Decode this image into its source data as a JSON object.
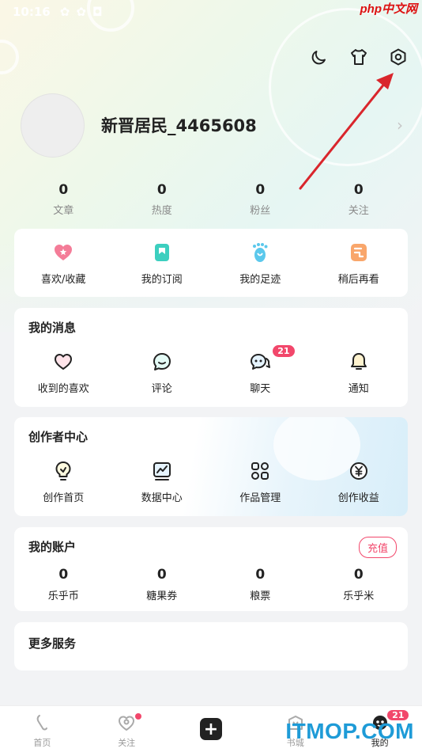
{
  "status_bar": {
    "time": "10:16"
  },
  "watermark_top": "php中文网",
  "watermark_bottom": "ITMOP.COM",
  "top_icons": [
    "moon-icon",
    "shirt-icon",
    "settings-icon"
  ],
  "profile": {
    "username": "新晋居民_4465608"
  },
  "stats": [
    {
      "value": "0",
      "label": "文章"
    },
    {
      "value": "0",
      "label": "热度"
    },
    {
      "value": "0",
      "label": "粉丝"
    },
    {
      "value": "0",
      "label": "关注"
    }
  ],
  "quick_links": [
    {
      "label": "喜欢/收藏",
      "icon": "heart-star-icon"
    },
    {
      "label": "我的订阅",
      "icon": "bookmark-icon"
    },
    {
      "label": "我的足迹",
      "icon": "footprint-icon"
    },
    {
      "label": "稍后再看",
      "icon": "watch-later-icon"
    }
  ],
  "messages": {
    "title": "我的消息",
    "items": [
      {
        "label": "收到的喜欢",
        "icon": "heart-icon"
      },
      {
        "label": "评论",
        "icon": "comment-icon"
      },
      {
        "label": "聊天",
        "icon": "chat-icon",
        "badge": "21"
      },
      {
        "label": "通知",
        "icon": "bell-icon"
      }
    ]
  },
  "creator": {
    "title": "创作者中心",
    "items": [
      {
        "label": "创作首页",
        "icon": "bulb-icon"
      },
      {
        "label": "数据中心",
        "icon": "data-chart-icon"
      },
      {
        "label": "作品管理",
        "icon": "grid-manage-icon"
      },
      {
        "label": "创作收益",
        "icon": "yen-icon"
      }
    ]
  },
  "account": {
    "title": "我的账户",
    "recharge_label": "充值",
    "items": [
      {
        "value": "0",
        "label": "乐乎币"
      },
      {
        "value": "0",
        "label": "糖果券"
      },
      {
        "value": "0",
        "label": "粮票"
      },
      {
        "value": "0",
        "label": "乐乎米"
      }
    ]
  },
  "more_services": {
    "title": "更多服务"
  },
  "bottom_nav": [
    {
      "label": "首页",
      "icon": "home-icon"
    },
    {
      "label": "关注",
      "icon": "follow-icon"
    },
    {
      "label": "",
      "icon": "plus-icon"
    },
    {
      "label": "书城",
      "icon": "bookstore-icon"
    },
    {
      "label": "我的",
      "icon": "mine-icon",
      "badge": "21"
    }
  ],
  "colors": {
    "accent": "#f2476b",
    "annotation_arrow": "#d9262c"
  }
}
